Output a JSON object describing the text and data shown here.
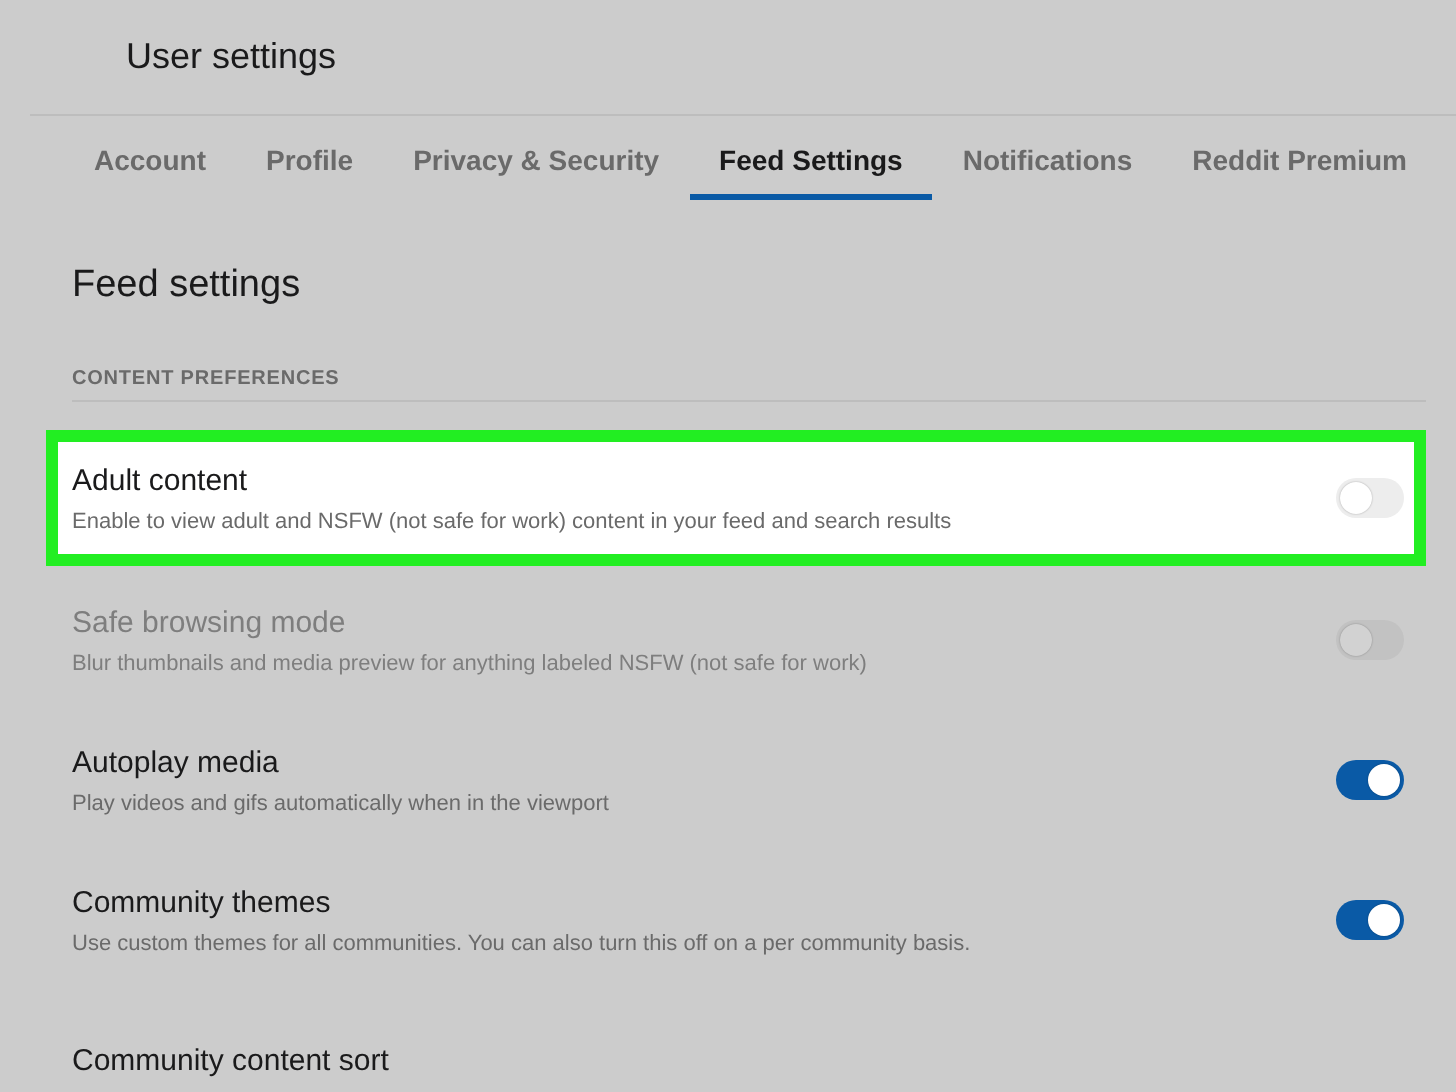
{
  "header": {
    "title": "User settings"
  },
  "tabs": [
    {
      "label": "Account",
      "selected": false
    },
    {
      "label": "Profile",
      "selected": false
    },
    {
      "label": "Privacy & Security",
      "selected": false
    },
    {
      "label": "Feed Settings",
      "selected": true
    },
    {
      "label": "Notifications",
      "selected": false
    },
    {
      "label": "Reddit Premium",
      "selected": false
    }
  ],
  "page_title": "Feed settings",
  "section": {
    "heading": "CONTENT PREFERENCES"
  },
  "settings": [
    {
      "title": "Adult content",
      "description": "Enable to view adult and NSFW (not safe for work) content in your feed and search results",
      "on": false,
      "disabled": false,
      "highlighted": true
    },
    {
      "title": "Safe browsing mode",
      "description": "Blur thumbnails and media preview for anything labeled NSFW (not safe for work)",
      "on": false,
      "disabled": true,
      "highlighted": false
    },
    {
      "title": "Autoplay media",
      "description": "Play videos and gifs automatically when in the viewport",
      "on": true,
      "disabled": false,
      "highlighted": false
    },
    {
      "title": "Community themes",
      "description": "Use custom themes for all communities. You can also turn this off on a per community basis.",
      "on": true,
      "disabled": false,
      "highlighted": false
    },
    {
      "title": "Community content sort"
    }
  ]
}
